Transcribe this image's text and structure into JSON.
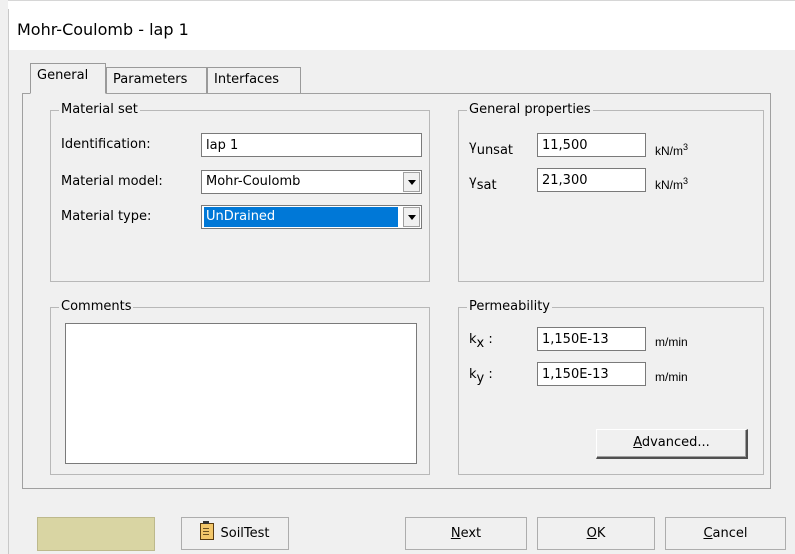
{
  "window": {
    "title": "Mohr-Coulomb - lap 1"
  },
  "tabs": [
    {
      "label": "General",
      "active": true
    },
    {
      "label": "Parameters",
      "active": false
    },
    {
      "label": "Interfaces",
      "active": false
    }
  ],
  "material_set": {
    "group_title": "Material set",
    "identification_label": "Identification:",
    "identification_value": "lap 1",
    "model_label": "Material model:",
    "model_value": "Mohr-Coulomb",
    "type_label": "Material type:",
    "type_value": "UnDrained"
  },
  "general_properties": {
    "group_title": "General properties",
    "gamma_unsat": {
      "symbol": "γ",
      "sub": "unsat",
      "value": "11,500",
      "unit": "kN/m",
      "unit_sup": "3"
    },
    "gamma_sat": {
      "symbol": "γ",
      "sub": "sat",
      "value": "21,300",
      "unit": "kN/m",
      "unit_sup": "3"
    }
  },
  "comments": {
    "group_title": "Comments",
    "value": ""
  },
  "permeability": {
    "group_title": "Permeability",
    "kx": {
      "symbol": "k",
      "sub": "x",
      "colon": ":",
      "value": "1,150E-13",
      "unit": "m/min"
    },
    "ky": {
      "symbol": "k",
      "sub": "y",
      "colon": ":",
      "value": "1,150E-13",
      "unit": "m/min"
    },
    "advanced": {
      "label_prefix": "",
      "label_underline": "A",
      "label_rest": "dvanced..."
    }
  },
  "footer": {
    "color_swatch": "#d9d5a3",
    "soiltest": {
      "label": "SoilTest",
      "icon": "clipboard-icon"
    },
    "next": {
      "u": "N",
      "rest": "ext"
    },
    "ok": {
      "u": "O",
      "rest": "K"
    },
    "cancel": {
      "u": "C",
      "rest": "ancel"
    }
  }
}
